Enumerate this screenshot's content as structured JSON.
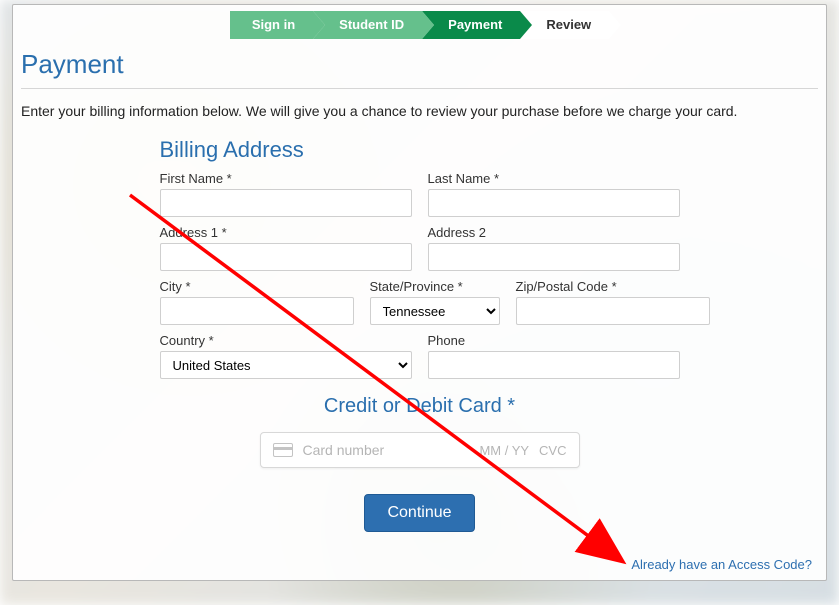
{
  "progress": {
    "steps": [
      {
        "label": "Sign in",
        "state": "done"
      },
      {
        "label": "Student ID",
        "state": "done"
      },
      {
        "label": "Payment",
        "state": "active"
      },
      {
        "label": "Review",
        "state": "later"
      }
    ]
  },
  "page": {
    "title": "Payment",
    "intro": "Enter your billing information below. We will give you a chance to review your purchase before we charge your card."
  },
  "billing": {
    "section_title": "Billing Address",
    "first_name": {
      "label": "First Name *",
      "value": ""
    },
    "last_name": {
      "label": "Last Name *",
      "value": ""
    },
    "address1": {
      "label": "Address 1 *",
      "value": ""
    },
    "address2": {
      "label": "Address 2",
      "value": ""
    },
    "city": {
      "label": "City *",
      "value": ""
    },
    "state": {
      "label": "State/Province *",
      "value": "Tennessee"
    },
    "zip": {
      "label": "Zip/Postal Code *",
      "value": ""
    },
    "country": {
      "label": "Country *",
      "value": "United States"
    },
    "phone": {
      "label": "Phone",
      "value": ""
    }
  },
  "card": {
    "section_title": "Credit or Debit Card *",
    "number_placeholder": "Card number",
    "exp_placeholder": "MM / YY",
    "cvc_placeholder": "CVC"
  },
  "actions": {
    "continue_label": "Continue",
    "access_code_link": "Already have an Access Code?"
  }
}
